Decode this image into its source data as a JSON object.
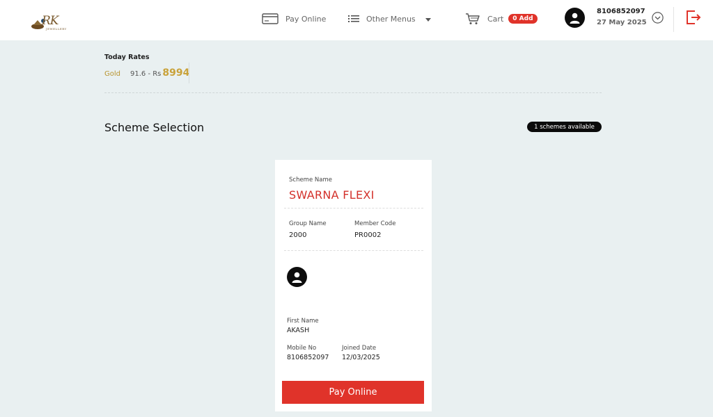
{
  "header": {
    "logo_text": "RK",
    "logo_sub": "JEWELLERY",
    "pay_online": "Pay Online",
    "other_menus": "Other Menus",
    "cart": "Cart",
    "cart_badge": "0 Add",
    "user_phone": "8106852097",
    "user_date": "27 May 2025"
  },
  "rates": {
    "title": "Today Rates",
    "metal": "Gold",
    "purity": "91.6 - Rs",
    "value": "8994"
  },
  "section": {
    "title": "Scheme Selection",
    "available": "1 schemes available"
  },
  "card": {
    "scheme_name_label": "Scheme Name",
    "scheme_name": "SWARNA FLEXI",
    "group_name_label": "Group Name",
    "group_name": "2000",
    "member_code_label": "Member Code",
    "member_code": "PR0002",
    "first_name_label": "First Name",
    "first_name": "AKASH",
    "mobile_label": "Mobile No",
    "mobile": "8106852097",
    "joined_label": "Joined Date",
    "joined": "12/03/2025",
    "pay_button": "Pay Online"
  },
  "colors": {
    "accent_red": "#e0332a",
    "gold": "#c9a23a",
    "background": "#e9f0f1"
  },
  "icons": [
    "card-icon",
    "list-icon",
    "cart-icon",
    "user-icon",
    "chevron-down-circle-icon",
    "logout-icon"
  ]
}
